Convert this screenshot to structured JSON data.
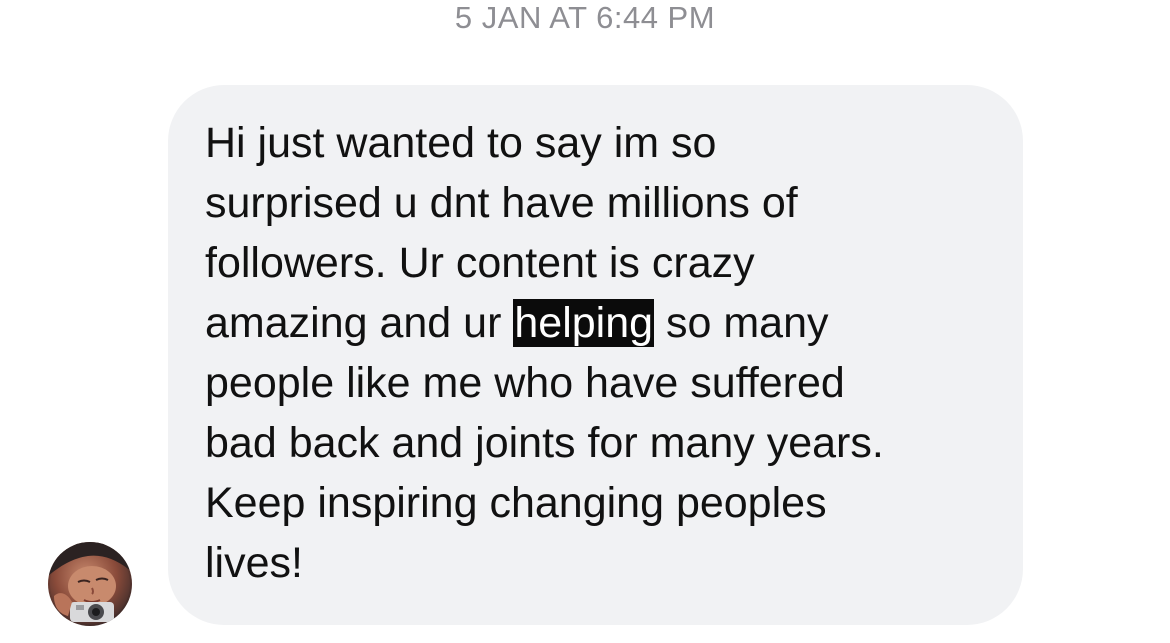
{
  "conversation": {
    "timestamp": "5 JAN AT 6:44 PM",
    "message": {
      "lines": [
        {
          "text": "Hi just wanted to say im so"
        },
        {
          "text": "surprised u dnt have millions of"
        },
        {
          "text": "followers. Ur content is crazy"
        },
        {
          "before": "amazing and ur ",
          "highlight": "helping",
          "after": " so many"
        },
        {
          "text": "people like me who have suffered"
        },
        {
          "text": "bad back and joints for many years."
        },
        {
          "text": "Keep inspiring changing peoples"
        },
        {
          "text": "lives!"
        }
      ]
    },
    "sender": {
      "avatar_icon": "user-avatar-photo"
    }
  },
  "colors": {
    "bubble_bg": "#f1f2f4",
    "timestamp_text": "#8e8e93",
    "message_text": "#111111",
    "highlight_bg": "#0b0b0b",
    "highlight_text": "#ffffff"
  }
}
